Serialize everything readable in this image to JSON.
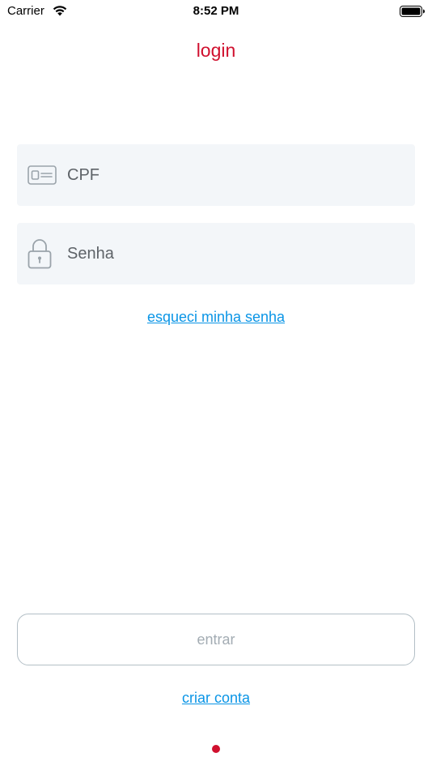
{
  "status_bar": {
    "carrier": "Carrier",
    "time": "8:52 PM",
    "wifi_icon": "wifi-icon",
    "battery_icon": "battery-icon"
  },
  "header": {
    "title": "login"
  },
  "form": {
    "cpf": {
      "placeholder": "CPF",
      "value": "",
      "icon": "id-card-icon"
    },
    "password": {
      "placeholder": "Senha",
      "value": "",
      "icon": "lock-icon"
    },
    "forgot_password_label": "esqueci minha senha"
  },
  "actions": {
    "enter_label": "entrar",
    "create_account_label": "criar conta"
  },
  "colors": {
    "brand_red": "#d0102e",
    "link_blue": "#0a95e6",
    "field_background": "#f3f6f9",
    "button_border": "#b3bfc6",
    "disabled_text": "#a3acb3"
  }
}
